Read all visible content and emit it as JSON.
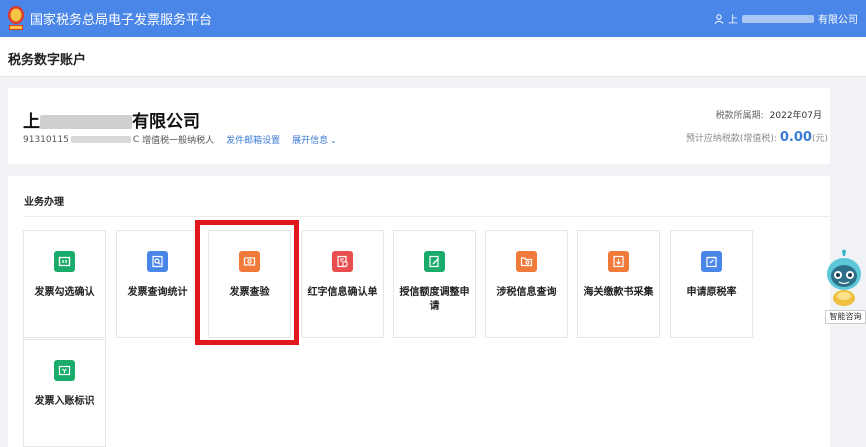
{
  "app": {
    "title": "国家税务总局电子发票服务平台",
    "user_prefix": "上",
    "user_suffix": "有限公司"
  },
  "page": {
    "title": "税务数字账户"
  },
  "company": {
    "name_prefix": "上",
    "name_suffix": "有限公司",
    "tax_id_prefix": "91310115",
    "tax_id_suffix": "C",
    "taxpayer_type": "增值税一般纳税人",
    "link_email_settings": "发件邮箱设置",
    "link_expand_info": "展开信息",
    "period_label": "税款所属期:",
    "period_value": "2022年07月",
    "estimate_label": "预计应纳税款(增值税):",
    "estimate_value": "0.00",
    "estimate_unit": "(元)"
  },
  "business": {
    "title": "业务办理",
    "tiles": [
      {
        "label": "发票勾选确认",
        "icon": "invoice-select-icon",
        "color": "#1aab6a"
      },
      {
        "label": "发票查询统计",
        "icon": "invoice-query-icon",
        "color": "#4a86e8"
      },
      {
        "label": "发票查验",
        "icon": "invoice-verify-icon",
        "color": "#f07a3a"
      },
      {
        "label": "红字信息确认单",
        "icon": "red-letter-icon",
        "color": "#e84e4e"
      },
      {
        "label": "授信额度调整申请",
        "icon": "credit-adjust-icon",
        "color": "#1aab6a"
      },
      {
        "label": "涉税信息查询",
        "icon": "tax-info-query-icon",
        "color": "#f07a3a"
      },
      {
        "label": "海关缴款书采集",
        "icon": "customs-collect-icon",
        "color": "#f07a3a"
      },
      {
        "label": "申请原税率",
        "icon": "apply-rate-icon",
        "color": "#4a86e8"
      },
      {
        "label": "发票入账标识",
        "icon": "invoice-book-icon",
        "color": "#1aab6a"
      }
    ]
  },
  "assistant": {
    "label": "智能咨询"
  }
}
